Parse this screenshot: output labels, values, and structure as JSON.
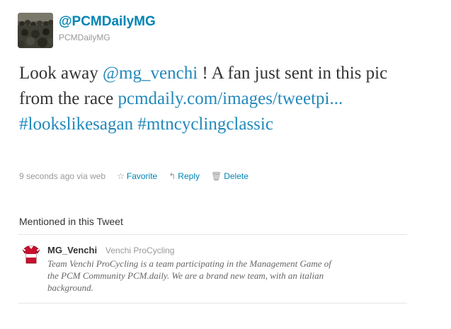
{
  "author": {
    "display_handle": "@PCMDailyMG",
    "screen_name": "PCMDailyMG"
  },
  "tweet": {
    "text_part1": "Look away ",
    "mention": "@mg_venchi",
    "text_part2": " ! A fan just sent in this pic from the race ",
    "link": "pcmdaily.com/images/tweetpi...",
    "hashtag1": "#lookslikesagan",
    "hashtag2": "#mtncyclingclassic"
  },
  "meta": {
    "timestamp": "9 seconds ago",
    "via": "via web",
    "favorite_label": "Favorite",
    "reply_label": "Reply",
    "delete_label": "Delete"
  },
  "mentioned": {
    "section_title": "Mentioned in this Tweet",
    "users": [
      {
        "screen_name": "MG_Venchi",
        "full_name": "Venchi ProCycling",
        "bio": "Team Venchi ProCycling is a team participating in the Management Game of the PCM Community PCM.daily. We are a brand new team, with an italian background."
      }
    ]
  },
  "colors": {
    "link": "#0084b4",
    "tweet_link": "#2288bb",
    "muted": "#999999",
    "text": "#333333"
  }
}
